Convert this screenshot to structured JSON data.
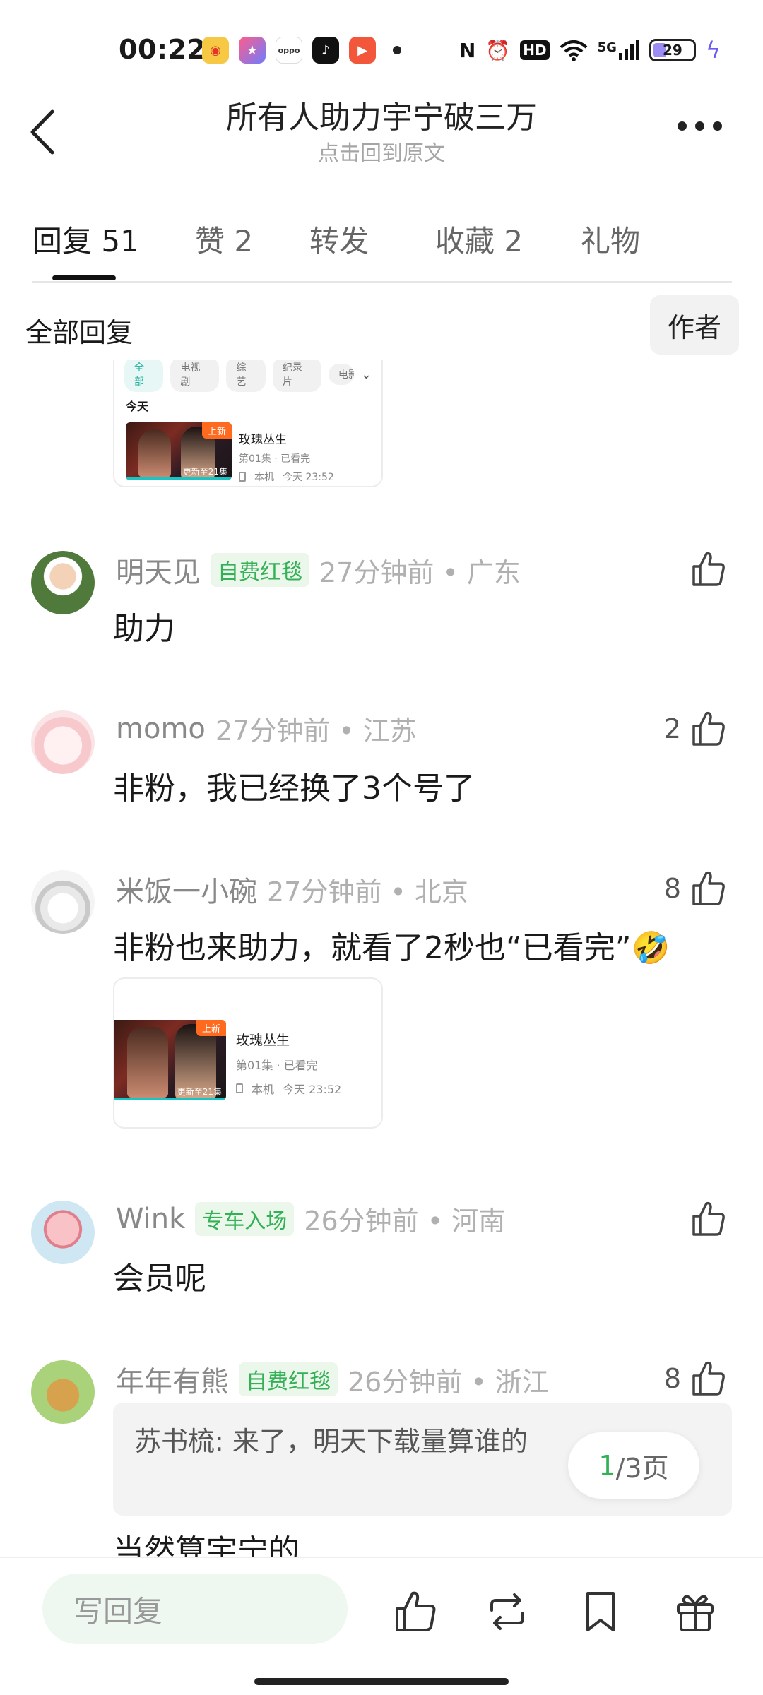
{
  "status_bar": {
    "time": "00:22",
    "app_icons": [
      "weibo-icon",
      "star-app-icon",
      "oppo-icon",
      "tiktok-icon",
      "video-app-icon"
    ],
    "indicators": [
      "nfc-icon",
      "alarm-icon",
      "hd-icon",
      "wifi-icon",
      "5g-signal-icon"
    ],
    "network": "5G",
    "hd": "HD",
    "nfc": "N",
    "battery": "29",
    "oppo_label": "oppo"
  },
  "header": {
    "title": "所有人助力宇宁破三万",
    "subtitle": "点击回到原文"
  },
  "tabs": [
    {
      "label": "回复 51",
      "active": true
    },
    {
      "label": "赞 2",
      "active": false
    },
    {
      "label": "转发",
      "active": false
    },
    {
      "label": "收藏 2",
      "active": false
    },
    {
      "label": "礼物",
      "active": false
    }
  ],
  "filter": {
    "label": "全部回复",
    "author_button": "作者"
  },
  "top_card": {
    "chips": [
      "全部",
      "电视剧",
      "综艺",
      "纪录片",
      "电影"
    ],
    "section": "今天",
    "show": {
      "name": "玫瑰丛生",
      "episode": "第01集 · 已看完",
      "device": "本机",
      "time": "今天 23:52",
      "new_tag": "上新",
      "update": "更新至21集"
    }
  },
  "comments": [
    {
      "name": "明天见",
      "badge": "自费红毯",
      "time": "27分钟前 • 广东",
      "text": "助力",
      "likes": ""
    },
    {
      "name": "momo",
      "badge": "",
      "time": "27分钟前 • 江苏",
      "text": "非粉，我已经换了3个号了",
      "likes": "2"
    },
    {
      "name": "米饭一小碗",
      "badge": "",
      "time": "27分钟前 • 北京",
      "text": "非粉也来助力，就看了2秒也“已看完”🤣",
      "likes": "8"
    },
    {
      "name": "Wink",
      "badge": "专车入场",
      "time": "26分钟前 • 河南",
      "text": "会员呢",
      "likes": ""
    },
    {
      "name": "年年有熊",
      "badge": "自费红毯",
      "time": "26分钟前 • 浙江",
      "text": "当然算宇宁的",
      "likes": "8"
    }
  ],
  "comment_card": {
    "show": {
      "name": "玫瑰丛生",
      "episode": "第01集 · 已看完",
      "device": "本机",
      "time": "今天 23:52",
      "new_tag": "上新",
      "update": "更新至21集"
    }
  },
  "quote": {
    "text": "苏书梳: 来了，明天下载量算谁的"
  },
  "pager": {
    "current": "1",
    "rest": "/3页"
  },
  "bottom_bar": {
    "placeholder": "写回复"
  },
  "colors": {
    "accent_green": "#34b056",
    "badge_bg": "#eaf7ea"
  }
}
